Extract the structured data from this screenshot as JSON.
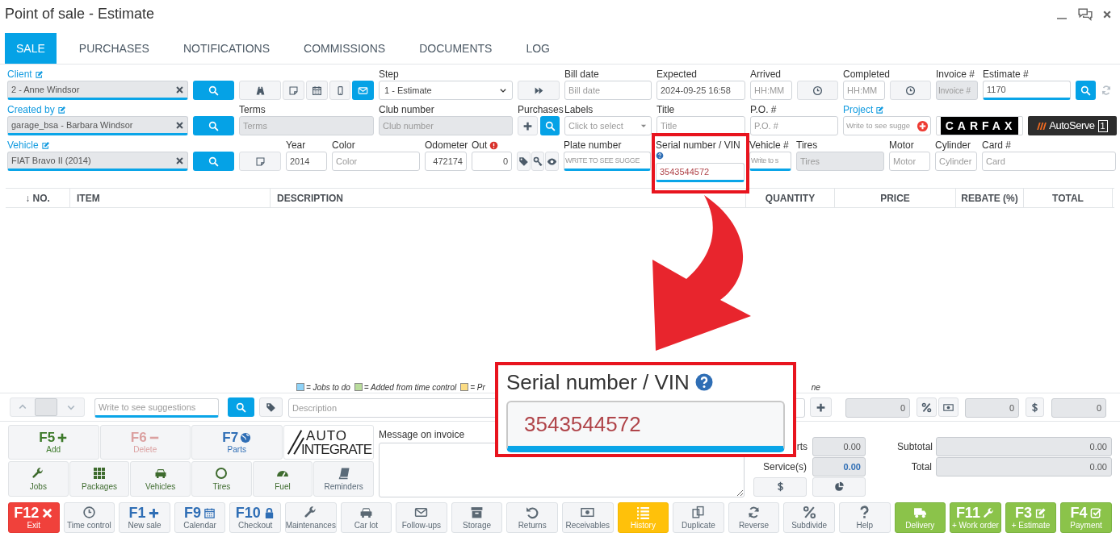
{
  "window": {
    "title": "Point of sale - Estimate"
  },
  "tabs": [
    {
      "label": "SALE",
      "selected": true
    },
    {
      "label": "PURCHASES",
      "selected": false
    },
    {
      "label": "NOTIFICATIONS",
      "selected": false
    },
    {
      "label": "COMMISSIONS",
      "selected": false
    },
    {
      "label": "DOCUMENTS",
      "selected": false
    },
    {
      "label": "LOG",
      "selected": false
    }
  ],
  "form": {
    "client": {
      "label": "Client",
      "value": "2 - Anne Windsor"
    },
    "step": {
      "label": "Step",
      "value": "1 - Estimate"
    },
    "bill_date": {
      "label": "Bill date",
      "placeholder": "Bill date"
    },
    "expected": {
      "label": "Expected",
      "value": "2024-09-25 16:58"
    },
    "arrived": {
      "label": "Arrived",
      "placeholder": "HH:MM"
    },
    "completed": {
      "label": "Completed",
      "placeholder": "HH:MM"
    },
    "invoice": {
      "label": "Invoice #",
      "placeholder": "Invoice #"
    },
    "estimate": {
      "label": "Estimate #",
      "value": "1170"
    },
    "created_by": {
      "label": "Created by",
      "value": "garage_bsa - Barbara Windsor"
    },
    "terms": {
      "label": "Terms",
      "placeholder": "Terms"
    },
    "club_number": {
      "label": "Club number",
      "placeholder": "Club number"
    },
    "purchases": {
      "label": "Purchases"
    },
    "labels": {
      "label": "Labels",
      "placeholder": "Click to select"
    },
    "title": {
      "label": "Title",
      "placeholder": "Title"
    },
    "po": {
      "label": "P.O. #",
      "placeholder": "P.O. #"
    },
    "project": {
      "label": "Project",
      "placeholder": "Write to see sugge"
    },
    "vehicle": {
      "label": "Vehicle",
      "value": "FIAT Bravo II (2014)"
    },
    "year": {
      "label": "Year",
      "value": "2014"
    },
    "color": {
      "label": "Color",
      "placeholder": "Color"
    },
    "odometer": {
      "label": "Odometer",
      "value": "472174"
    },
    "out": {
      "label": "Out",
      "value": "0"
    },
    "plate": {
      "label": "Plate number",
      "placeholder": "WRITE TO SEE SUGGE"
    },
    "serial": {
      "label": "Serial number / VIN",
      "value": "3543544572"
    },
    "vehicle_no": {
      "label": "Vehicle #",
      "placeholder": "Write to s"
    },
    "tires": {
      "label": "Tires",
      "placeholder": "Tires"
    },
    "motor": {
      "label": "Motor",
      "placeholder": "Motor"
    },
    "cylinder": {
      "label": "Cylinder",
      "placeholder": "Cylinder"
    },
    "card": {
      "label": "Card #",
      "placeholder": "Card"
    }
  },
  "logos": {
    "carfax": "CARFAX",
    "autoserve": "AutoServe",
    "autoserve_badge": "1",
    "autointegrate": [
      "AUTO",
      "INTEGRATE"
    ]
  },
  "table": {
    "columns": [
      "↓ NO.",
      "ITEM",
      "DESCRIPTION",
      "QUANTITY",
      "PRICE",
      "REBATE (%)",
      "TOTAL"
    ]
  },
  "legend": [
    {
      "text": "= Jobs to do",
      "color": "#8fd3f8"
    },
    {
      "text": "= Added from time control",
      "color": "#b9dc9c"
    },
    {
      "text": "= Pr",
      "color": "#fbdc84"
    }
  ],
  "legend_tail": "ne",
  "entry": {
    "item_placeholder": "Write to see suggestions",
    "description_placeholder": "Description",
    "quantity": "0",
    "rebate": "0",
    "total": "0"
  },
  "quick_buttons": [
    {
      "key": "F5",
      "label": "Add"
    },
    {
      "key": "F6",
      "label": "Delete"
    },
    {
      "key": "F7",
      "label": "Parts"
    }
  ],
  "category_buttons": [
    "Jobs",
    "Packages",
    "Vehicles",
    "Tires",
    "Fuel",
    "Reminders"
  ],
  "message": {
    "label": "Message on invoice"
  },
  "totals": {
    "parts_label": "rts",
    "parts": "0.00",
    "services_label": "Service(s)",
    "services": "0.00",
    "subtotal_label": "Subtotal",
    "subtotal": "0.00",
    "total_label": "Total",
    "total": "0.00"
  },
  "actions": [
    {
      "kind": "exit",
      "key": "F12",
      "label": "Exit"
    },
    {
      "kind": "plain",
      "label": "Time control"
    },
    {
      "kind": "plain",
      "key": "F1",
      "label": "New sale"
    },
    {
      "kind": "plain",
      "key": "F9",
      "label": "Calendar"
    },
    {
      "kind": "plain",
      "key": "F10",
      "label": "Checkout"
    },
    {
      "kind": "plain",
      "label": "Maintenances"
    },
    {
      "kind": "plain",
      "label": "Car lot"
    },
    {
      "kind": "plain",
      "label": "Follow-ups"
    },
    {
      "kind": "plain",
      "label": "Storage"
    },
    {
      "kind": "plain",
      "label": "Returns"
    },
    {
      "kind": "plain",
      "label": "Receivables"
    },
    {
      "kind": "highlight",
      "label": "History"
    },
    {
      "kind": "plain",
      "label": "Duplicate"
    },
    {
      "kind": "plain",
      "label": "Reverse"
    },
    {
      "kind": "plain",
      "label": "Subdivide"
    },
    {
      "kind": "plain",
      "label": "Help"
    },
    {
      "kind": "action",
      "label": "Delivery"
    },
    {
      "kind": "action",
      "key": "F11",
      "label": "+ Work order"
    },
    {
      "kind": "action",
      "key": "F3",
      "label": "+ Estimate"
    },
    {
      "kind": "action",
      "key": "F4",
      "label": "Payment"
    }
  ],
  "callout": {
    "label": "Serial number / VIN",
    "value": "3543544572"
  }
}
